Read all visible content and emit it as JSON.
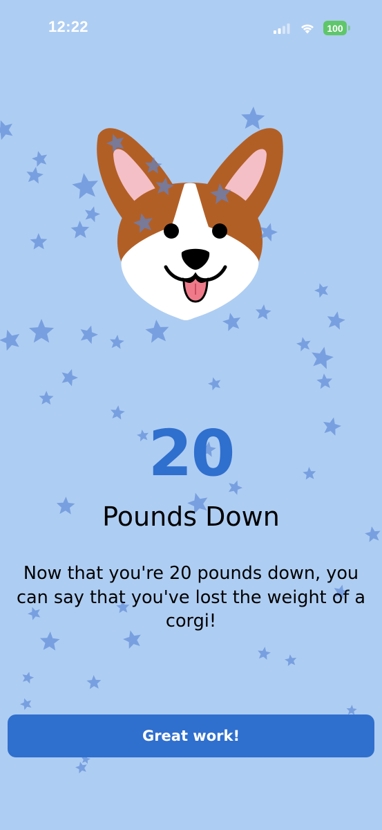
{
  "status_bar": {
    "time": "12:22",
    "battery": "100",
    "icons": [
      "signal-icon",
      "wifi-icon",
      "battery-icon"
    ],
    "battery_color": "#5fc66a"
  },
  "hero": {
    "image": "corgi-face",
    "decoration": "star-icon"
  },
  "milestone": {
    "number": "20",
    "label": "Pounds Down",
    "message": "Now that you're 20 pounds down, you can say that you've lost the weight of a corgi!"
  },
  "actions": {
    "primary_label": "Great work!"
  },
  "colors": {
    "background": "#aecdf2",
    "accent": "#2f6fce",
    "star": "#5a87d6",
    "corgi_fur": "#b25f26",
    "corgi_tongue": "#ef7b8a"
  }
}
